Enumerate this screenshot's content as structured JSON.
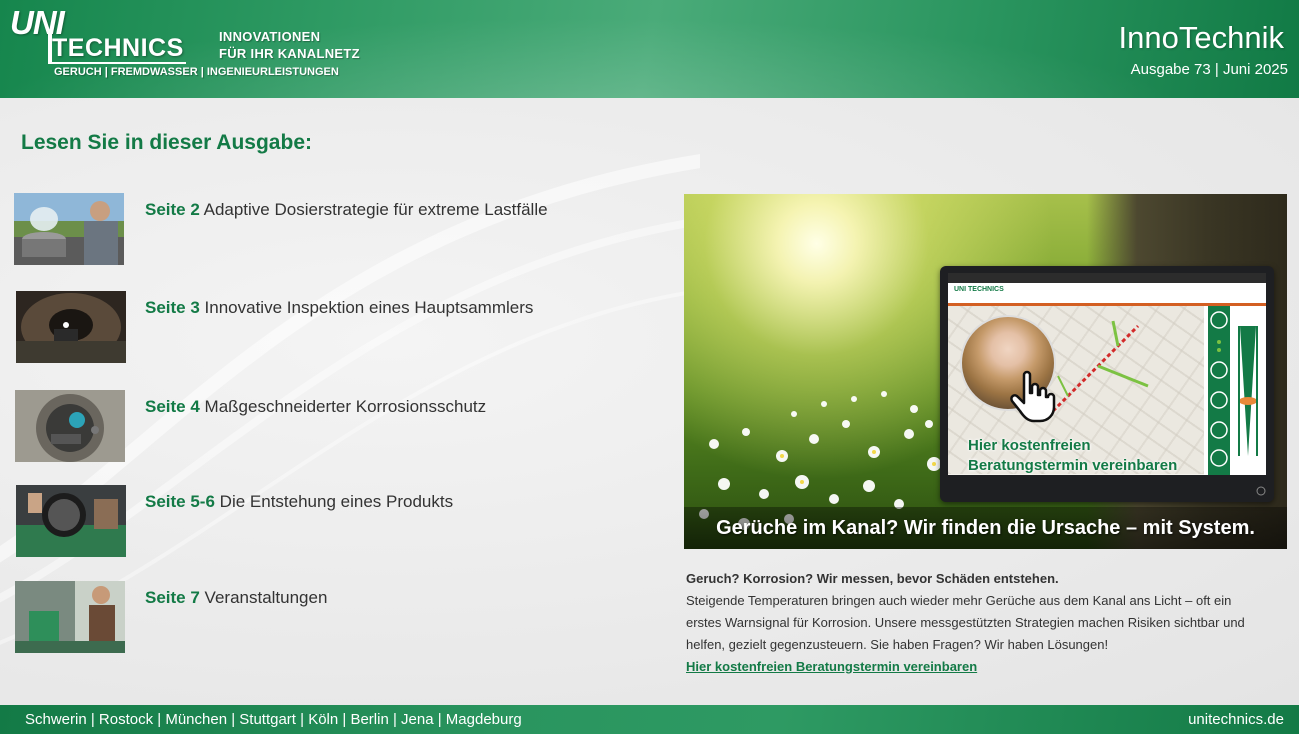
{
  "header": {
    "logo_uni": "UNI",
    "logo_tech": "TECHNICS",
    "logo_sub": "GERUCH | FREMDWASSER | INGENIEURLEISTUNGEN",
    "tagline_1": "INNOVATIONEN",
    "tagline_2": "FÜR IHR KANALNETZ",
    "brand": "InnoTechnik",
    "issue": "Ausgabe 73 | Juni 2025"
  },
  "main": {
    "heading": "Lesen Sie in dieser Ausgabe:",
    "toc": [
      {
        "page": "Seite 2",
        "title": "Adaptive Dosierstrategie für extreme Lastfälle"
      },
      {
        "page": "Seite 3",
        "title": "Innovative Inspektion eines Hauptsammlers"
      },
      {
        "page": "Seite 4",
        "title": "Maßgeschneiderter Korrosionsschutz"
      },
      {
        "page": "Seite 5-6",
        "title": "Die Entstehung eines Produkts"
      },
      {
        "page": "Seite 7",
        "title": "Veranstaltungen"
      }
    ]
  },
  "hero": {
    "screen_logo": "UNI TECHNICS",
    "cta_line1": "Hier kostenfreien",
    "cta_line2": "Beratungstermin vereinbaren",
    "caption": "Gerüche im Kanal? Wir finden die Ursache – mit System."
  },
  "article": {
    "lead": "Geruch? Korrosion? Wir messen, bevor Schäden entstehen.",
    "body": "Steigende Temperaturen bringen auch wieder mehr Gerüche aus dem Kanal ans Licht – oft ein erstes Warnsignal für Korrosion. Unsere messgestützten Strategien machen Risiken sichtbar und helfen, gezielt gegenzusteuern. Sie haben Fragen? Wir haben Lösungen!",
    "link": "Hier kostenfreien Beratungstermin vereinbaren"
  },
  "footer": {
    "cities": "Schwerin | Rostock | München | Stuttgart | Köln | Berlin | Jena | Magdeburg",
    "site": "unitechnics.de"
  },
  "colors": {
    "brand_green": "#137a46",
    "accent_orange": "#d35f22"
  }
}
